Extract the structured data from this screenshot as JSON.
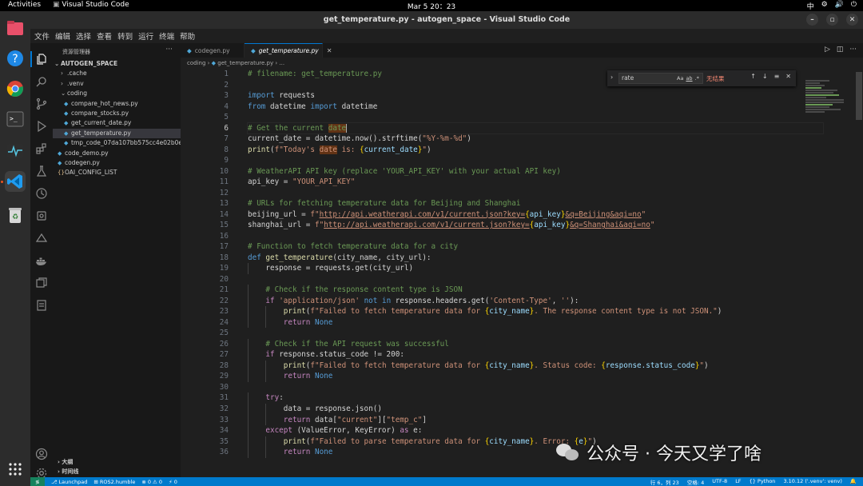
{
  "topbar": {
    "activities": "Activities",
    "app_name": "Visual Studio Code",
    "clock": "Mar 5  20：23",
    "tray": [
      "中",
      "⚙",
      "🔊",
      "⏻"
    ]
  },
  "window": {
    "title": "get_temperature.py - autogen_space - Visual Studio Code"
  },
  "menu": [
    "文件",
    "编辑",
    "选择",
    "查看",
    "转到",
    "运行",
    "终端",
    "帮助"
  ],
  "explorer": {
    "header": "资源管理器",
    "more": "···",
    "root": "AUTOGEN_SPACE",
    "items": [
      {
        "label": ".cache",
        "kind": "folder",
        "depth": 1,
        "open": false
      },
      {
        "label": ".venv",
        "kind": "folder",
        "depth": 1,
        "open": false
      },
      {
        "label": "coding",
        "kind": "folder",
        "depth": 1,
        "open": true
      },
      {
        "label": "compare_hot_news.py",
        "kind": "py",
        "depth": 2
      },
      {
        "label": "compare_stocks.py",
        "kind": "py",
        "depth": 2
      },
      {
        "label": "get_current_date.py",
        "kind": "py",
        "depth": 2
      },
      {
        "label": "get_temperature.py",
        "kind": "py",
        "depth": 2,
        "selected": true
      },
      {
        "label": "tmp_code_07da107bb575cc4e02b0e1...",
        "kind": "py",
        "depth": 2
      },
      {
        "label": "code_demo.py",
        "kind": "py",
        "depth": 1
      },
      {
        "label": "codegen.py",
        "kind": "py",
        "depth": 1
      },
      {
        "label": "OAI_CONFIG_LIST",
        "kind": "json",
        "depth": 1
      }
    ],
    "outline": "大纲",
    "timeline": "时间线"
  },
  "tabs": [
    {
      "label": "codegen.py",
      "active": false
    },
    {
      "label": "get_temperature.py",
      "active": true
    }
  ],
  "breadcrumb": {
    "folder": "coding",
    "file": "get_temperature.py",
    "more": "..."
  },
  "find": {
    "value": "rate",
    "result": "无结果",
    "options": [
      "Aa",
      "ab",
      ".*"
    ]
  },
  "code": {
    "current_line": 6,
    "lines": [
      [
        [
          "cm",
          "# filename: get_temperature.py"
        ]
      ],
      [],
      [
        [
          "k",
          "import"
        ],
        [
          "p",
          " requests"
        ]
      ],
      [
        [
          "k",
          "from"
        ],
        [
          "p",
          " datetime "
        ],
        [
          "k",
          "import"
        ],
        [
          "p",
          " datetime"
        ]
      ],
      [],
      [
        [
          "cm",
          "# Get the current "
        ],
        [
          "cmh",
          "date"
        ],
        [
          "caret",
          ""
        ]
      ],
      [
        [
          "p",
          "current_date = datetime.now().strftime("
        ],
        [
          "s",
          "\"%Y-%m-%d\""
        ],
        [
          "p",
          ")"
        ]
      ],
      [
        [
          "f",
          "print"
        ],
        [
          "p",
          "("
        ],
        [
          "s",
          "f\"Today's "
        ],
        [
          "sh",
          "date"
        ],
        [
          "s",
          " is: "
        ],
        [
          "b",
          "{"
        ],
        [
          "v",
          "current_date"
        ],
        [
          "b",
          "}"
        ],
        [
          "s",
          "\""
        ],
        [
          "p",
          ")"
        ]
      ],
      [],
      [
        [
          "cm",
          "# WeatherAPI API key (replace 'YOUR_API_KEY' with your actual API key)"
        ]
      ],
      [
        [
          "p",
          "api_key = "
        ],
        [
          "s",
          "\"YOUR_API_KEY\""
        ]
      ],
      [],
      [
        [
          "cm",
          "# URLs for fetching temperature data for Beijing and Shanghai"
        ]
      ],
      [
        [
          "p",
          "beijing_url = "
        ],
        [
          "s",
          "f\""
        ],
        [
          "u",
          "http://api.weatherapi.com/v1/current.json?key="
        ],
        [
          "b",
          "{"
        ],
        [
          "v",
          "api_key"
        ],
        [
          "b",
          "}"
        ],
        [
          "u",
          "&q=Beijing&aqi=no"
        ],
        [
          "s",
          "\""
        ]
      ],
      [
        [
          "p",
          "shanghai_url = "
        ],
        [
          "s",
          "f\""
        ],
        [
          "u",
          "http://api.weatherapi.com/v1/current.json?key="
        ],
        [
          "b",
          "{"
        ],
        [
          "v",
          "api_key"
        ],
        [
          "b",
          "}"
        ],
        [
          "u",
          "&q=Shanghai&aqi=no"
        ],
        [
          "s",
          "\""
        ]
      ],
      [],
      [
        [
          "cm",
          "# Function to fetch temperature data for a city"
        ]
      ],
      [
        [
          "k",
          "def"
        ],
        [
          "p",
          " "
        ],
        [
          "f",
          "get_temperature"
        ],
        [
          "p",
          "(city_name, city_url):"
        ]
      ],
      [
        [
          "i1",
          ""
        ],
        [
          "p",
          "response = requests.get(city_url)"
        ]
      ],
      [],
      [
        [
          "i1",
          ""
        ],
        [
          "cm",
          "# Check if the response content type is JSON"
        ]
      ],
      [
        [
          "i1",
          ""
        ],
        [
          "kc",
          "if"
        ],
        [
          "p",
          " "
        ],
        [
          "s",
          "'application/json'"
        ],
        [
          "p",
          " "
        ],
        [
          "k",
          "not"
        ],
        [
          "p",
          " "
        ],
        [
          "k",
          "in"
        ],
        [
          "p",
          " response.headers.get("
        ],
        [
          "s",
          "'Content-Type'"
        ],
        [
          "p",
          ", "
        ],
        [
          "s",
          "''"
        ],
        [
          "p",
          "):"
        ]
      ],
      [
        [
          "i2",
          ""
        ],
        [
          "f",
          "print"
        ],
        [
          "p",
          "("
        ],
        [
          "s",
          "f\"Failed to fetch temperature data for "
        ],
        [
          "b",
          "{"
        ],
        [
          "v",
          "city_name"
        ],
        [
          "b",
          "}"
        ],
        [
          "s",
          ". The response content type is not JSON.\""
        ],
        [
          "p",
          ")"
        ]
      ],
      [
        [
          "i2",
          ""
        ],
        [
          "kc",
          "return"
        ],
        [
          "p",
          " "
        ],
        [
          "k",
          "None"
        ]
      ],
      [],
      [
        [
          "i1",
          ""
        ],
        [
          "cm",
          "# Check if the API request was successful"
        ]
      ],
      [
        [
          "i1",
          ""
        ],
        [
          "kc",
          "if"
        ],
        [
          "p",
          " response.status_code != 200:"
        ]
      ],
      [
        [
          "i2",
          ""
        ],
        [
          "f",
          "print"
        ],
        [
          "p",
          "("
        ],
        [
          "s",
          "f\"Failed to fetch temperature data for "
        ],
        [
          "b",
          "{"
        ],
        [
          "v",
          "city_name"
        ],
        [
          "b",
          "}"
        ],
        [
          "s",
          ". Status code: "
        ],
        [
          "b",
          "{"
        ],
        [
          "v",
          "response.status_code"
        ],
        [
          "b",
          "}"
        ],
        [
          "s",
          "\""
        ],
        [
          "p",
          ")"
        ]
      ],
      [
        [
          "i2",
          ""
        ],
        [
          "kc",
          "return"
        ],
        [
          "p",
          " "
        ],
        [
          "k",
          "None"
        ]
      ],
      [],
      [
        [
          "i1",
          ""
        ],
        [
          "kc",
          "try"
        ],
        [
          "p",
          ":"
        ]
      ],
      [
        [
          "i2",
          ""
        ],
        [
          "p",
          "data = response.json()"
        ]
      ],
      [
        [
          "i2",
          ""
        ],
        [
          "kc",
          "return"
        ],
        [
          "p",
          " data["
        ],
        [
          "s",
          "\"current\""
        ],
        [
          "p",
          "]["
        ],
        [
          "s",
          "\"temp_c\""
        ],
        [
          "p",
          "]"
        ]
      ],
      [
        [
          "i1",
          ""
        ],
        [
          "kc",
          "except"
        ],
        [
          "p",
          " (ValueError, KeyError) "
        ],
        [
          "kc",
          "as"
        ],
        [
          "p",
          " e:"
        ]
      ],
      [
        [
          "i2",
          ""
        ],
        [
          "f",
          "print"
        ],
        [
          "p",
          "("
        ],
        [
          "s",
          "f\"Failed to parse temperature data for "
        ],
        [
          "b",
          "{"
        ],
        [
          "v",
          "city_name"
        ],
        [
          "b",
          "}"
        ],
        [
          "s",
          ". Error: "
        ],
        [
          "b",
          "{"
        ],
        [
          "v",
          "e"
        ],
        [
          "b",
          "}"
        ],
        [
          "s",
          "\""
        ],
        [
          "p",
          ")"
        ]
      ],
      [
        [
          "i2",
          ""
        ],
        [
          "kc",
          "return"
        ],
        [
          "p",
          " "
        ],
        [
          "k",
          "None"
        ]
      ]
    ]
  },
  "status": {
    "branch": "Launchpad",
    "ros": "ROS2.humble",
    "problems": "⊗ 0 ⚠ 0",
    "ports": "⚡ 0",
    "position": "行 6，列 23",
    "spaces": "空格: 4",
    "encoding": "UTF-8",
    "eol": "LF",
    "language": "{} Python",
    "interpreter": "3.10.12 ('.venv': venv)"
  },
  "watermark": {
    "text": "公众号 · 今天又学了啥"
  },
  "colors": {
    "accent": "#007acc",
    "activity_indicator": "#0078d4",
    "ubuntu_orange": "#e95420"
  }
}
